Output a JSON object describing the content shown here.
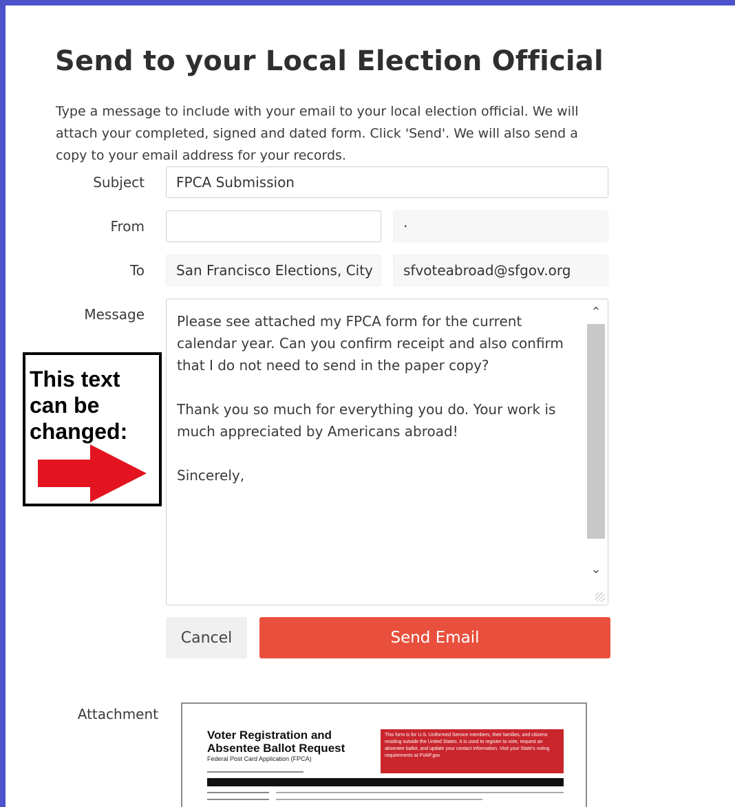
{
  "dialog": {
    "title": "Send to your Local Election Official",
    "intro": "Type a message to include with your email to your local election official. We will attach your completed, signed and dated form. Click 'Send'. We will also send a copy to your email address for your records."
  },
  "form": {
    "subject_label": "Subject",
    "subject_value": "FPCA Submission",
    "from_label": "From",
    "from_name_value": "",
    "from_email_value": "·",
    "to_label": "To",
    "to_name_value": "San Francisco Elections, City",
    "to_email_value": "sfvoteabroad@sfgov.org",
    "message_label": "Message",
    "message_paragraphs": [
      "Please see attached my FPCA form for the current calendar year. Can you confirm receipt and also confirm that I do not need to send in the paper copy?",
      "Thank you so much for everything you do. Your work is much appreciated by Americans abroad!",
      "Sincerely,"
    ]
  },
  "buttons": {
    "cancel_label": "Cancel",
    "send_label": "Send Email"
  },
  "annotation": {
    "text": "This text can be changed:",
    "arrow_color": "#e3141f"
  },
  "attachment": {
    "label": "Attachment",
    "doc_title": "Voter Registration and Absentee Ballot Request",
    "doc_subtitle": "Federal Post Card Application (FPCA)",
    "doc_notice": "This form is for U.S. Uniformed Service members, their families, and citizens residing outside the United States. It is used to register to vote, request an absentee ballot, and update your contact information. Visit your State's voting requirements at FVAP.gov"
  },
  "colors": {
    "frame": "#4c52c9",
    "send_button": "#e8503d",
    "doc_red": "#c9252d"
  }
}
